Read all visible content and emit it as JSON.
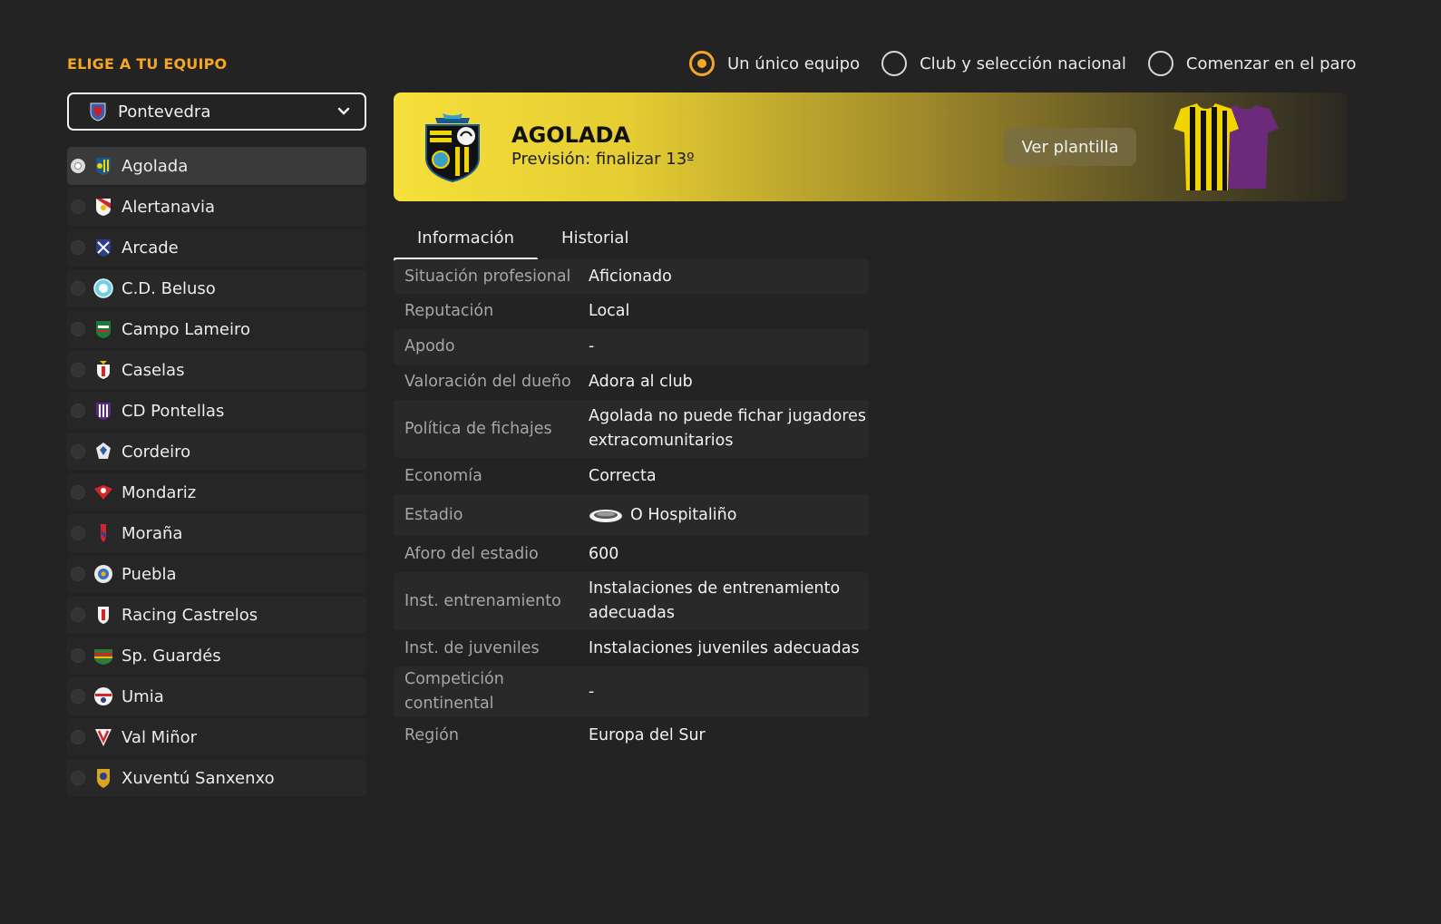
{
  "heading": "ELIGE A TU EQUIPO",
  "modes": [
    {
      "label": "Un único equipo",
      "selected": true
    },
    {
      "label": "Club y selección nacional",
      "selected": false
    },
    {
      "label": "Comenzar en el paro",
      "selected": false
    }
  ],
  "dropdown": {
    "value": "Pontevedra"
  },
  "teams": [
    {
      "name": "Agolada"
    },
    {
      "name": "Alertanavia"
    },
    {
      "name": "Arcade"
    },
    {
      "name": "C.D. Beluso"
    },
    {
      "name": "Campo Lameiro"
    },
    {
      "name": "Caselas"
    },
    {
      "name": "CD Pontellas"
    },
    {
      "name": "Cordeiro"
    },
    {
      "name": "Mondariz"
    },
    {
      "name": "Moraña"
    },
    {
      "name": "Puebla"
    },
    {
      "name": "Racing Castrelos"
    },
    {
      "name": "Sp. Guardés"
    },
    {
      "name": "Umia"
    },
    {
      "name": "Val Miñor"
    },
    {
      "name": "Xuventú Sanxenxo"
    }
  ],
  "banner": {
    "club_name": "AGOLADA",
    "forecast": "Previsión: finalizar 13º",
    "squad_button": "Ver plantilla"
  },
  "tabs": [
    {
      "label": "Información"
    },
    {
      "label": "Historial"
    }
  ],
  "info": [
    {
      "key": "Situación profesional",
      "value": "Aficionado"
    },
    {
      "key": "Reputación",
      "value": "Local"
    },
    {
      "key": "Apodo",
      "value": "-"
    },
    {
      "key": "Valoración del dueño",
      "value": "Adora al club"
    },
    {
      "key": "Política de fichajes",
      "value": "Agolada no puede fichar jugadores extracomunitarios"
    },
    {
      "key": "Economía",
      "value": "Correcta"
    },
    {
      "key": "Estadio",
      "value": "O Hospitaliño"
    },
    {
      "key": "Aforo del estadio",
      "value": "600"
    },
    {
      "key": "Inst. entrenamiento",
      "value": "Instalaciones de entrenamiento adecuadas"
    },
    {
      "key": "Inst. de juveniles",
      "value": "Instalaciones juveniles adecuadas"
    },
    {
      "key": "Competición continental",
      "value": "-"
    },
    {
      "key": "Región",
      "value": "Europa del Sur"
    }
  ],
  "colors": {
    "accent": "#f5a623",
    "background": "#232323",
    "banner_yellow": "#f6e03a"
  }
}
